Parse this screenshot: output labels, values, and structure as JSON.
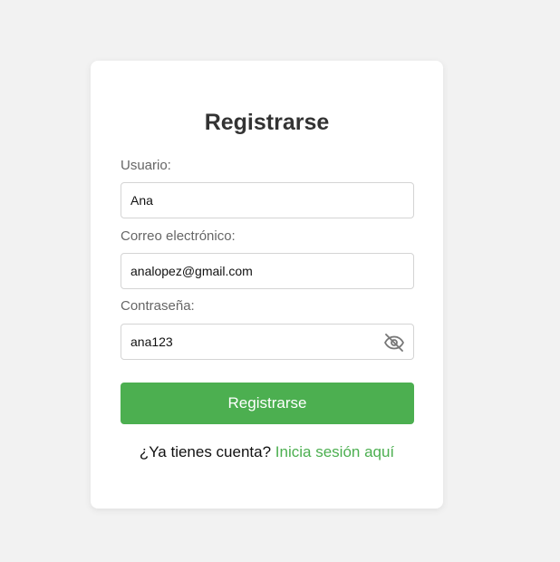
{
  "form": {
    "title": "Registrarse",
    "username": {
      "label": "Usuario:",
      "value": "Ana"
    },
    "email": {
      "label": "Correo electrónico:",
      "value": "analopez@gmail.com"
    },
    "password": {
      "label": "Contraseña:",
      "value": "ana123",
      "toggle_icon": "eye-off-icon"
    },
    "submit_label": "Registrarse",
    "footer": {
      "prompt": "¿Ya tienes cuenta?",
      "link_label": "Inicia sesión aquí"
    }
  },
  "colors": {
    "background": "#f2f2f2",
    "card": "#ffffff",
    "accent": "#4caf50",
    "title": "#333333",
    "label": "#666666"
  }
}
